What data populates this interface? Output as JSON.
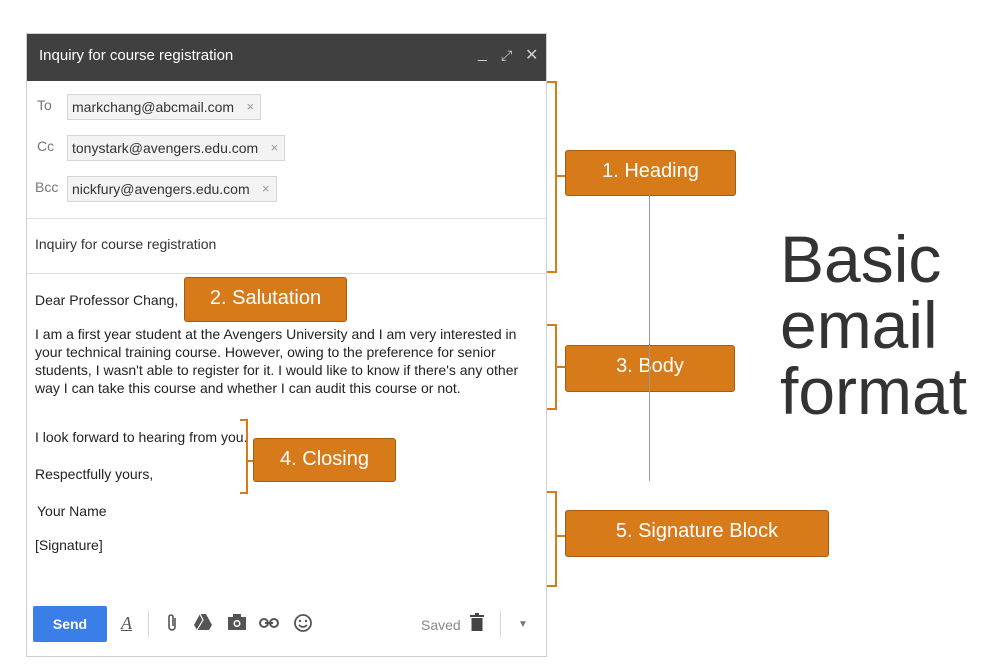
{
  "window": {
    "title": "Inquiry for course registration",
    "controls": [
      "_",
      "⤢",
      "✕"
    ]
  },
  "recipients": {
    "to_label": "To",
    "to": "markchang@abcmail.com",
    "cc_label": "Cc",
    "cc": "tonystark@avengers.edu.com",
    "bcc_label": "Bcc",
    "bcc": "nickfury@avengers.edu.com",
    "remove_glyph": "×"
  },
  "subject": "Inquiry for course registration",
  "body": {
    "salutation": "Dear Professor Chang,",
    "paragraph": "I am a first year student at the Avengers University and I am very interested in your technical training course. However, owing to the preference for senior students, I wasn't able to register for it. I would like to know if there's any other way I can take this course and whether I can audit this course or not.",
    "closing_line": "I look forward to hearing from you.",
    "sign_off": "Respectfully yours,",
    "name": "Your Name",
    "signature": "[Signature]"
  },
  "toolbar": {
    "send_label": "Send",
    "saved_label": "Saved",
    "icons": [
      "format-text-icon",
      "attach-icon",
      "drive-icon",
      "photo-icon",
      "link-icon",
      "emoji-icon",
      "trash-icon",
      "more-options-icon"
    ]
  },
  "annotations": {
    "heading": "1. Heading",
    "salutation": "2. Salutation",
    "body": "3. Body",
    "closing": "4. Closing",
    "signature": "5. Signature Block",
    "accent_color": "#d77a1a"
  },
  "caption": {
    "line1": "Basic",
    "line2": "email",
    "line3": "format"
  }
}
